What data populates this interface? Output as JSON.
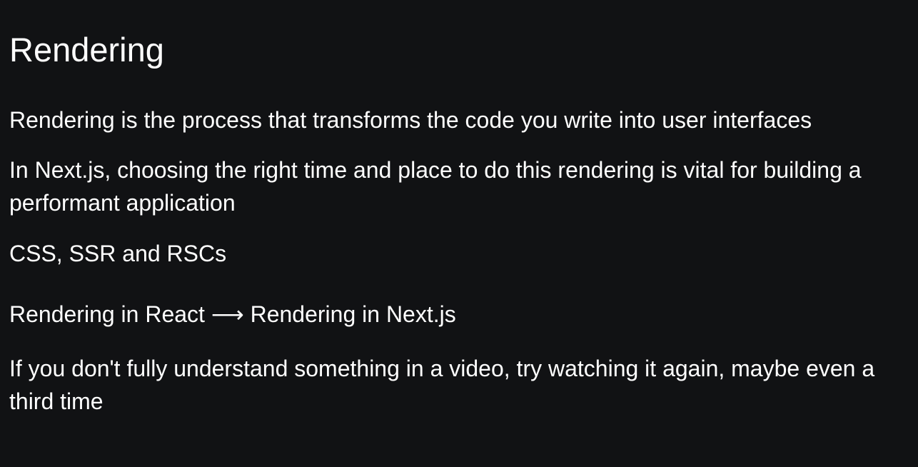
{
  "slide": {
    "title": "Rendering",
    "paragraphs": [
      "Rendering is the process that transforms the code you write into user interfaces",
      "In Next.js, choosing the right time and place to do this rendering is vital for building a performant application",
      "CSS, SSR and RSCs",
      "Rendering in React ⟶ Rendering in Next.js",
      "If you don't fully understand something in a video, try watching it again, maybe even a third time"
    ]
  },
  "colors": {
    "background": "#111214",
    "text": "#ffffff"
  }
}
